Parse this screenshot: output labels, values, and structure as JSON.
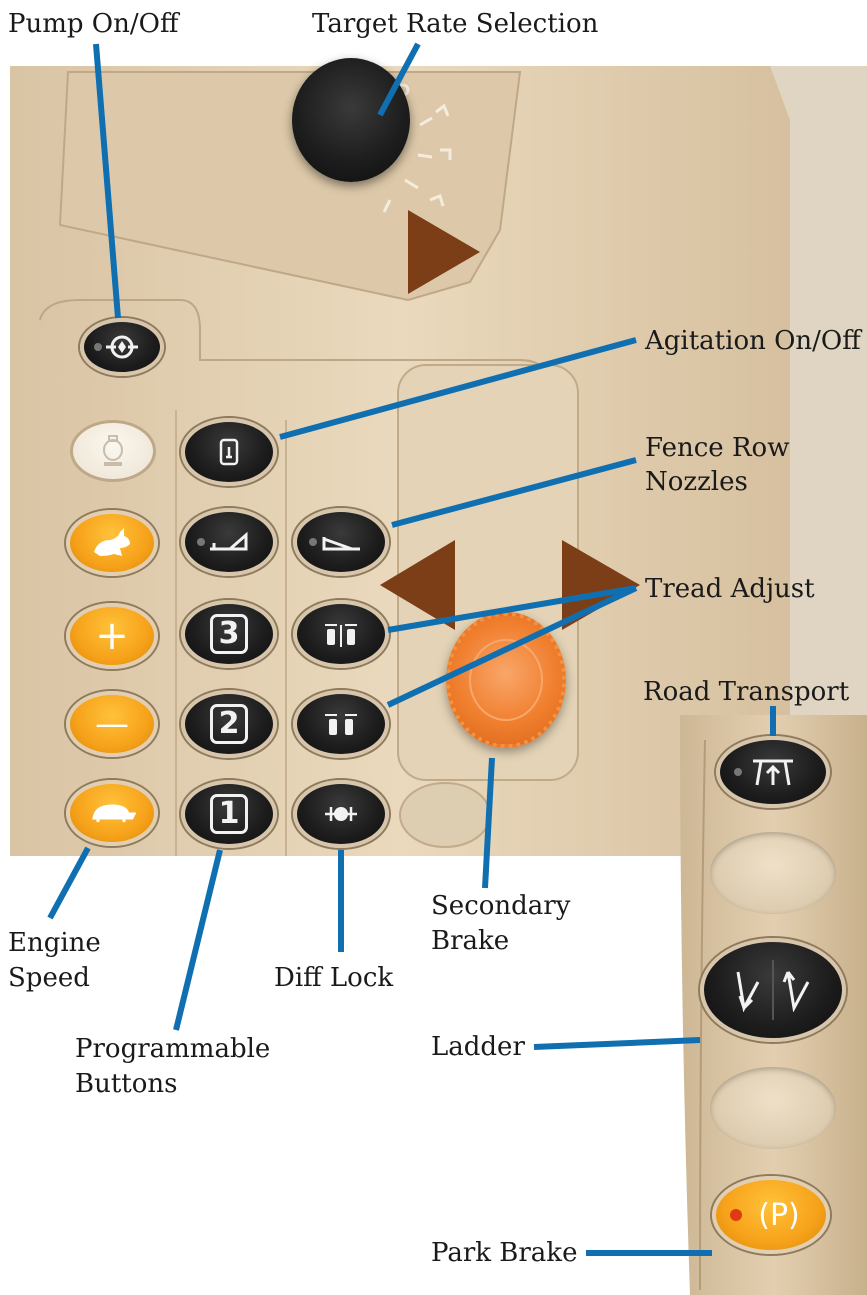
{
  "labels": {
    "pump": "Pump On/Off",
    "target_rate": "Target Rate Selection",
    "agitation": "Agitation On/Off",
    "fence_row_1": "Fence Row",
    "fence_row_2": "Nozzles",
    "tread_adjust": "Tread Adjust",
    "road_transport": "Road Transport",
    "engine_speed_1": "Engine",
    "engine_speed_2": "Speed",
    "programmable_1": "Programmable",
    "programmable_2": "Buttons",
    "diff_lock": "Diff Lock",
    "secondary_brake_1": "Secondary",
    "secondary_brake_2": "Brake",
    "ladder": "Ladder",
    "park_brake": "Park Brake"
  },
  "buttons": {
    "prog_3": "3",
    "prog_2": "2",
    "prog_1": "1",
    "plus": "+",
    "minus": "—",
    "park": "(P)"
  },
  "colors": {
    "panel": "#e6d3b6",
    "callout": "#0f6fb1",
    "arrow": "#7b3e17",
    "orange": "#f6a21a",
    "knob_orange": "#f07f2e"
  },
  "icons": [
    "pump-icon",
    "engine-icon",
    "rabbit-icon",
    "turtle-icon",
    "boom-icon",
    "fence-row-icon",
    "tread-out-icon",
    "tread-in-icon",
    "diff-lock-icon",
    "road-transport-icon",
    "ladder-down-icon",
    "ladder-up-icon",
    "agitation-icon"
  ]
}
